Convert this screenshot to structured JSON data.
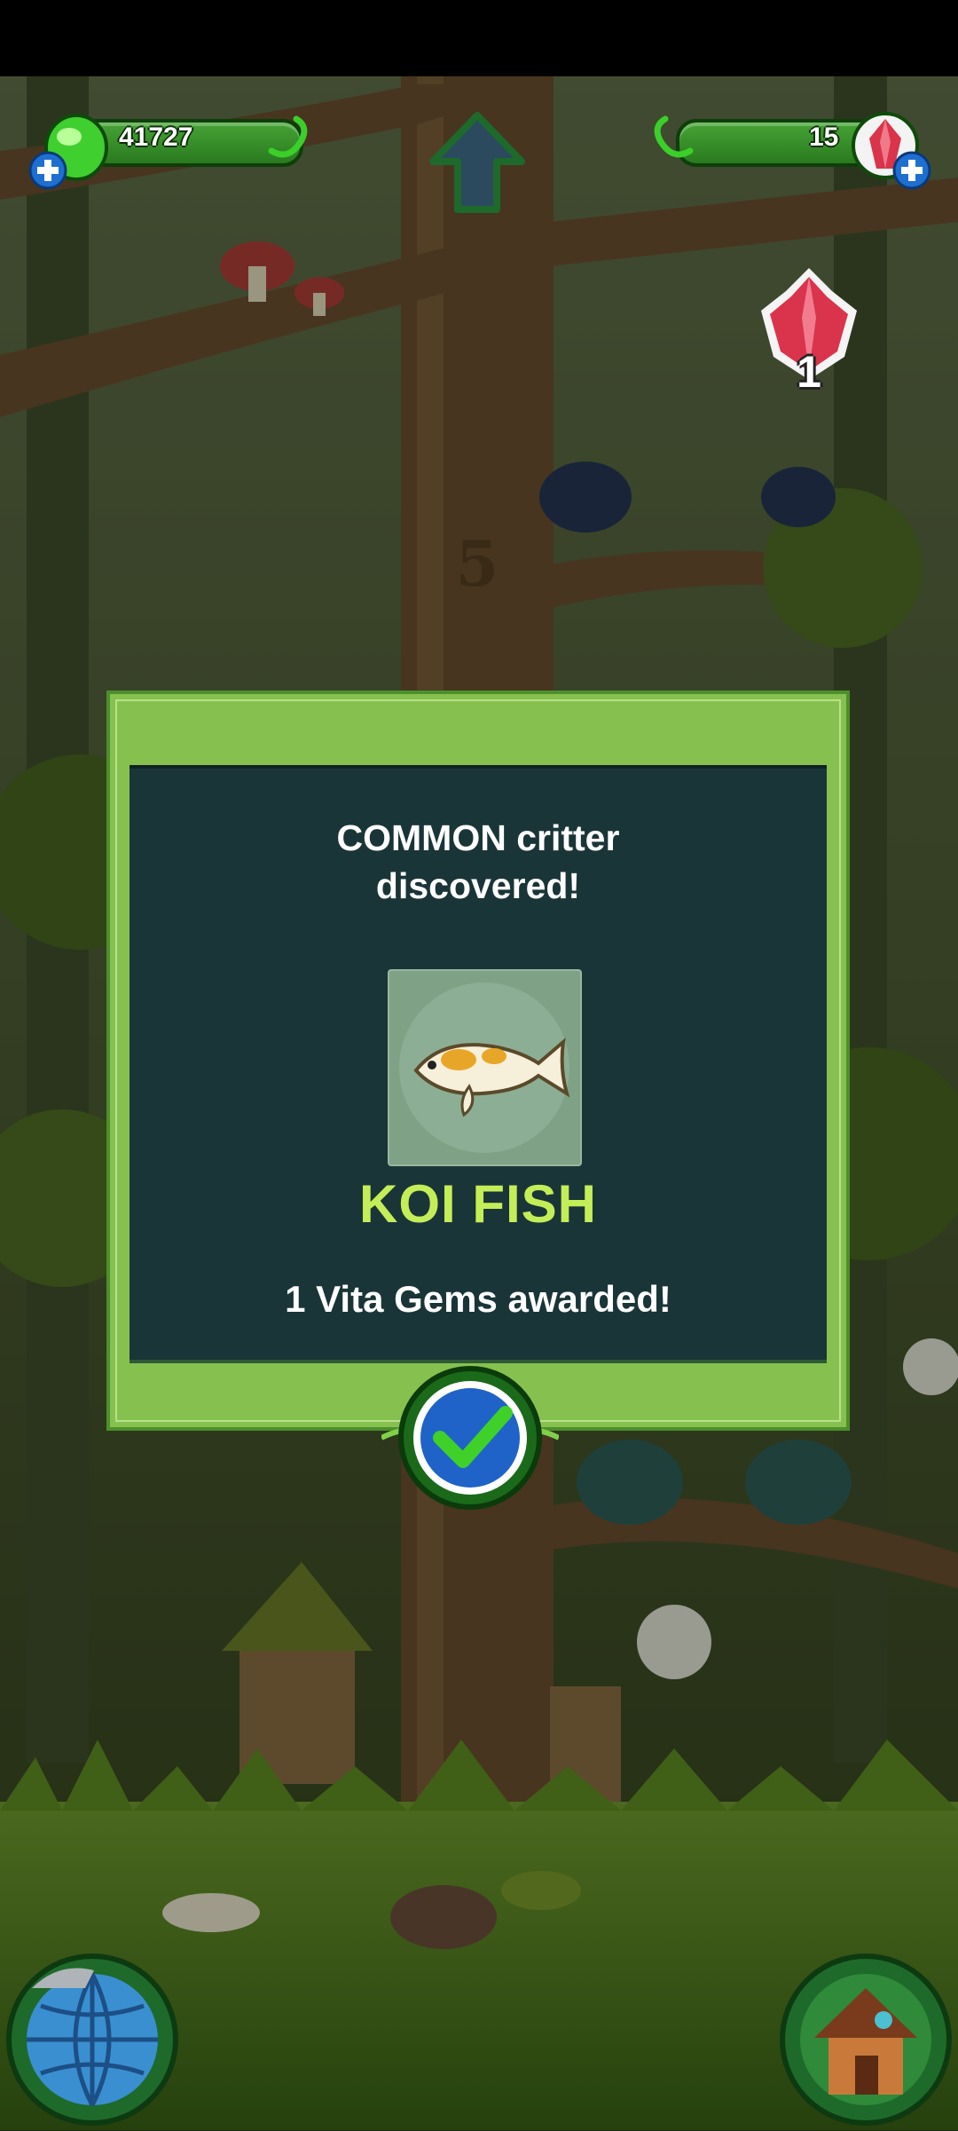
{
  "hud": {
    "vita_count": "41727",
    "gem_count": "15",
    "gem_badge": "1"
  },
  "dialog": {
    "headline_line1": "COMMON critter",
    "headline_line2": "discovered!",
    "critter_name": "KOI FISH",
    "reward_text": "1 Vita Gems awarded!"
  },
  "scene": {
    "tree_level": "5"
  },
  "colors": {
    "accent_green": "#86c14f",
    "panel_dark": "#1a3538",
    "name_lime": "#c4ee57",
    "gem_red": "#d9344b"
  },
  "icons": {
    "vita": "green-gem-icon",
    "gem": "red-crystal-icon",
    "add": "plus-icon",
    "up": "up-arrow-icon",
    "confirm": "checkmark-icon",
    "world": "globe-icon",
    "home": "house-icon"
  }
}
